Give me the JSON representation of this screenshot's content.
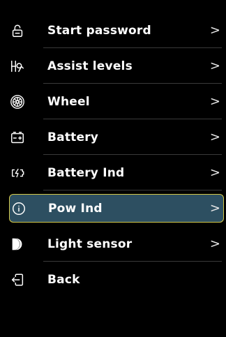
{
  "menu": {
    "items": [
      {
        "label": "Start password",
        "icon": "lock-icon",
        "chevron": ">"
      },
      {
        "label": "Assist levels",
        "icon": "assist-level-icon",
        "chevron": ">"
      },
      {
        "label": "Wheel",
        "icon": "wheel-icon",
        "chevron": ">"
      },
      {
        "label": "Battery",
        "icon": "battery-icon",
        "chevron": ">"
      },
      {
        "label": "Battery Ind",
        "icon": "battery-indicator-icon",
        "chevron": ">"
      },
      {
        "label": "Pow Ind",
        "icon": "power-indicator-icon",
        "chevron": ">",
        "selected": true
      },
      {
        "label": "Light sensor",
        "icon": "light-sensor-icon",
        "chevron": ">"
      },
      {
        "label": "Back",
        "icon": "back-icon"
      }
    ]
  },
  "colors": {
    "background": "#000000",
    "text": "#ffffff",
    "selected_fill": "#2d4f61",
    "selected_border": "#d4c94a",
    "divider": "#3a3a3a"
  }
}
